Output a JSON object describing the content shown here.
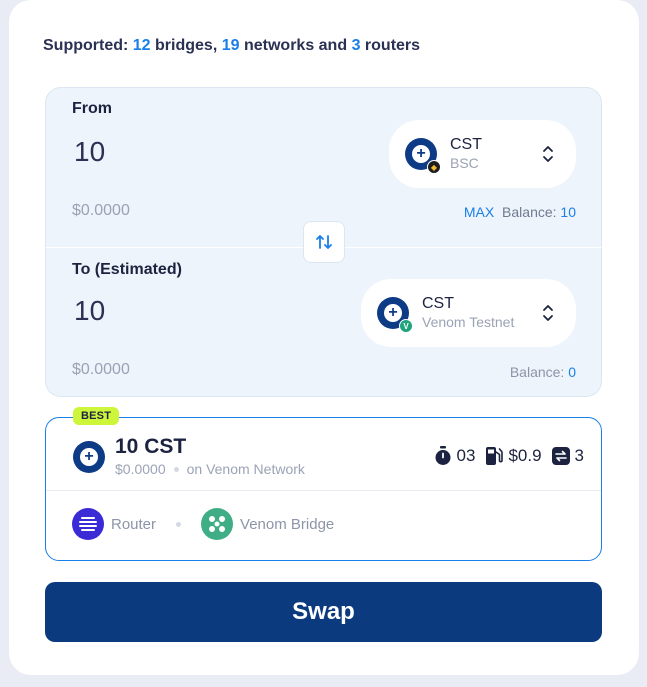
{
  "supported": {
    "prefix": "Supported:",
    "bridges_count": "12",
    "bridges_label": "bridges,",
    "networks_count": "19",
    "networks_label": "networks and",
    "routers_count": "3",
    "routers_label": "routers"
  },
  "from": {
    "label": "From",
    "amount": "10",
    "usd_value": "$0.0000",
    "token_symbol": "CST",
    "token_chain": "BSC",
    "max_label": "MAX",
    "balance_label": "Balance:",
    "balance_value": "10"
  },
  "to": {
    "label": "To (Estimated)",
    "amount": "10",
    "usd_value": "$0.0000",
    "token_symbol": "CST",
    "token_chain": "Venom Testnet",
    "balance_label": "Balance:",
    "balance_value": "0"
  },
  "route": {
    "badge": "BEST",
    "amount": "10 CST",
    "usd_value": "$0.0000",
    "network": "on Venom Network",
    "time": "03",
    "gas": "$0.9",
    "steps": "3",
    "providers": [
      {
        "name": "Router",
        "icon": "router-logo-icon"
      },
      {
        "name": "Venom Bridge",
        "icon": "venom-bridge-logo-icon"
      }
    ]
  },
  "swap_button": "Swap",
  "colors": {
    "accent": "#1a7fe8",
    "primary_button": "#0b3b7e",
    "best_badge": "#cdf53a",
    "panel_bg": "#edf4fb"
  }
}
